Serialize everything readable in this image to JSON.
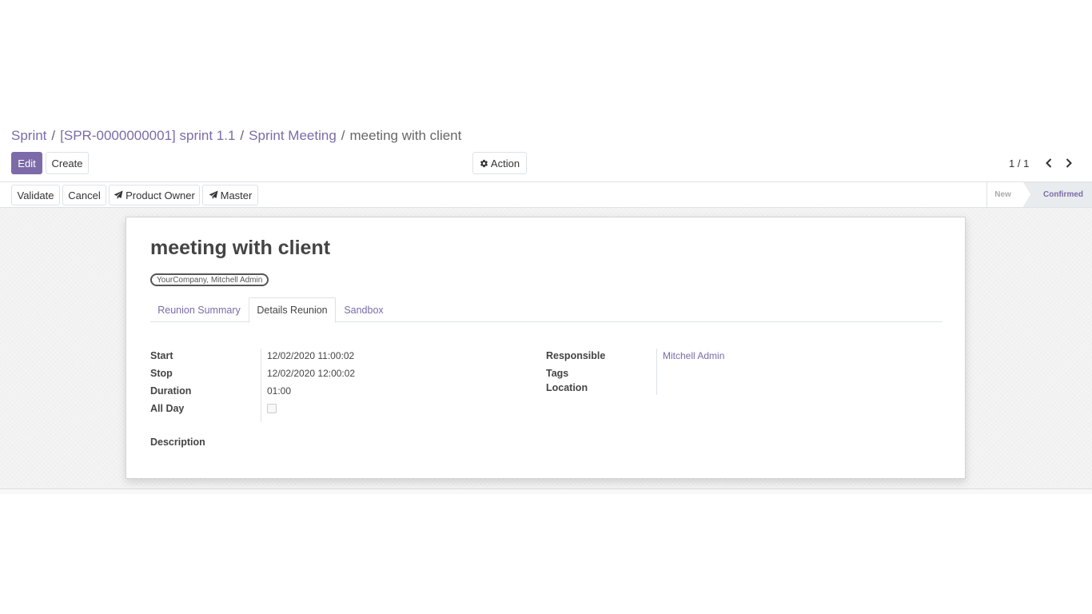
{
  "breadcrumb": {
    "items": [
      "Sprint",
      "[SPR-0000000001] sprint 1.1",
      "Sprint Meeting"
    ],
    "current": "meeting with client",
    "separator": "/"
  },
  "toolbar": {
    "edit_label": "Edit",
    "create_label": "Create",
    "action_label": "Action",
    "action_icon": "gear-icon"
  },
  "pager": {
    "value": "1 / 1"
  },
  "statusbar": {
    "buttons": {
      "validate": "Validate",
      "cancel": "Cancel",
      "product_owner": "Product Owner",
      "master": "Master"
    },
    "send_icon": "paper-plane-icon",
    "stages": {
      "new": "New",
      "confirmed": "Confirmed"
    },
    "current_stage": "Confirmed"
  },
  "record": {
    "title": "meeting with client",
    "attendees_tag": "YourCompany, Mitchell Admin"
  },
  "tabs": [
    {
      "label": "Reunion Summary",
      "active": false
    },
    {
      "label": "Details Reunion",
      "active": true
    },
    {
      "label": "Sandbox",
      "active": false
    }
  ],
  "details": {
    "start_label": "Start",
    "start_value": "12/02/2020 11:00:02",
    "stop_label": "Stop",
    "stop_value": "12/02/2020 12:00:02",
    "duration_label": "Duration",
    "duration_value": "01:00",
    "allday_label": "All Day",
    "allday_checked": false,
    "description_label": "Description",
    "responsible_label": "Responsible",
    "responsible_value": "Mitchell Admin",
    "tags_label": "Tags",
    "location_label": "Location"
  },
  "colors": {
    "accent": "#7c6ba8"
  }
}
